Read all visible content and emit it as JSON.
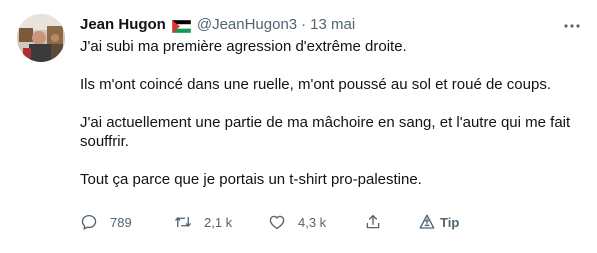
{
  "tweet": {
    "author": {
      "name": "Jean Hugon",
      "handle": "@JeanHugon3",
      "avatar_icon": "avatar-photo",
      "flag_icon": "palestine-flag-icon"
    },
    "separator": "·",
    "date": "13 mai",
    "more_icon": "more-horizontal-icon",
    "paragraphs": [
      "J'ai subi ma première agression d'extrême droite.",
      "Ils m'ont coincé dans une ruelle, m'ont poussé au sol et roué de coups.",
      "J'ai actuellement une partie de ma mâchoire en sang, et l'autre qui me fait souffrir.",
      "Tout ça parce que je portais un t-shirt pro-palestine."
    ],
    "actions": {
      "reply": {
        "icon": "reply-icon",
        "count": "789"
      },
      "retweet": {
        "icon": "retweet-icon",
        "count": "2,1 k"
      },
      "like": {
        "icon": "like-icon",
        "count": "4,3 k"
      },
      "share": {
        "icon": "share-icon"
      },
      "tip": {
        "icon": "tip-icon",
        "label": "Tip"
      }
    },
    "colors": {
      "text": "#0f1419",
      "secondary": "#536471",
      "background": "#ffffff"
    }
  }
}
